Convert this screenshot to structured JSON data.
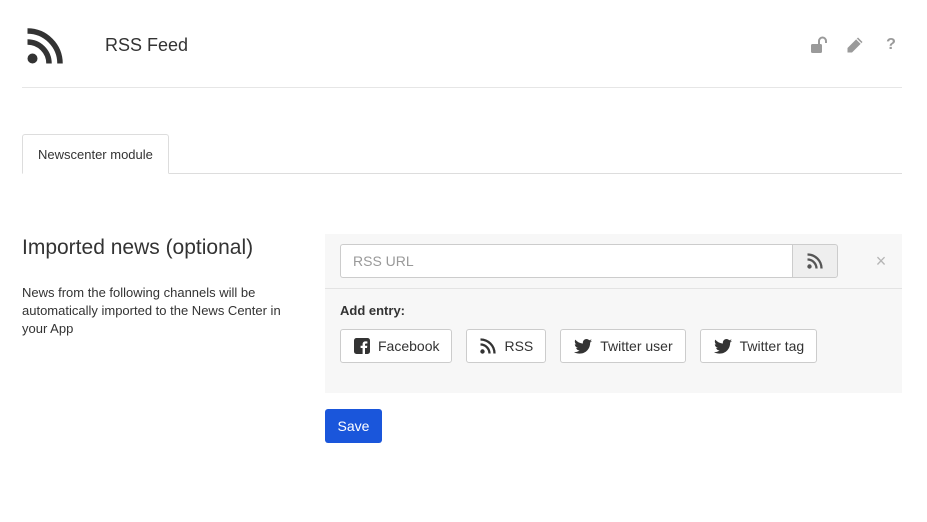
{
  "header": {
    "icon": "rss-icon",
    "title": "RSS Feed",
    "actions": [
      "unlock-icon",
      "pencil-icon",
      "question-icon"
    ],
    "help_glyph": "?"
  },
  "tabs": [
    {
      "label": "Newscenter module",
      "active": true
    }
  ],
  "section": {
    "title": "Imported news (optional)",
    "description": "News from the following channels will be automatically imported to the News Center in your App"
  },
  "feed_entry": {
    "url_placeholder": "RSS URL",
    "url_value": "",
    "remove_glyph": "×"
  },
  "add_entry": {
    "label": "Add entry:",
    "buttons": [
      {
        "label": "Facebook",
        "icon": "facebook-icon"
      },
      {
        "label": "RSS",
        "icon": "rss-icon"
      },
      {
        "label": "Twitter user",
        "icon": "twitter-icon"
      },
      {
        "label": "Twitter tag",
        "icon": "twitter-icon"
      }
    ]
  },
  "save_label": "Save",
  "colors": {
    "primary": "#1a56db",
    "panel_bg": "#f7f7f7",
    "icon_gray": "#9a9a9a"
  }
}
